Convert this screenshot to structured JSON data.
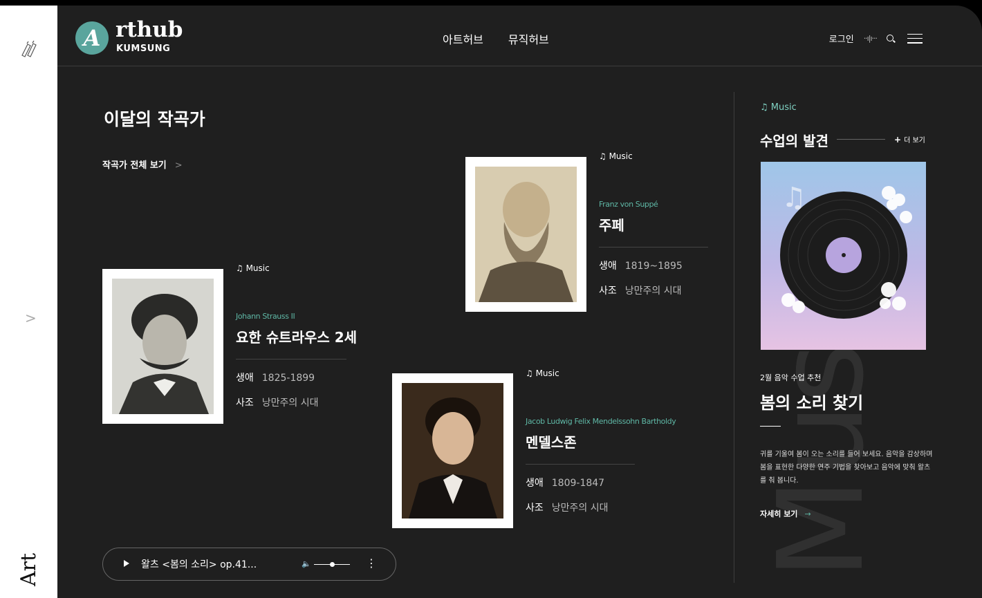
{
  "rail": {
    "art_label": "Art"
  },
  "brand": {
    "logo_letter": "A",
    "name": "rthub",
    "sub": "KUMSUNG"
  },
  "nav": {
    "items": [
      "아트허브",
      "뮤직허브"
    ]
  },
  "utils": {
    "login": "로그인",
    "wave": "··ı|ı···"
  },
  "section": {
    "title": "이달의 작곡가",
    "all_link": "작곡가 전체 보기",
    "all_link_chevron": ">"
  },
  "composers": [
    {
      "tag": "♫ Music",
      "eng": "Johann Strauss II",
      "kor": "요한 슈트라우스 2세",
      "life_label": "생애",
      "life": "1825-1899",
      "era_label": "사조",
      "era": "낭만주의 시대"
    },
    {
      "tag": "♫ Music",
      "eng": "Franz von Suppé",
      "kor": "주페",
      "life_label": "생애",
      "life": "1819~1895",
      "era_label": "사조",
      "era": "낭만주의 시대"
    },
    {
      "tag": "♫ Music",
      "eng": "Jacob Ludwig Felix Mendelssohn Bartholdy",
      "kor": "멘델스존",
      "life_label": "생애",
      "life": "1809-1847",
      "era_label": "사조",
      "era": "낭만주의 시대"
    }
  ],
  "player": {
    "track": "왈츠 <봄의 소리> op.41...",
    "volume": 0.5
  },
  "side": {
    "tag": "♫ Music",
    "title": "수업의 발견",
    "more": "더 보기",
    "rec_label": "2월 음악 수업 추천",
    "rec_title": "봄의 소리 찾기",
    "rec_desc": "귀를 기울여 봄이 오는 소리를 들어 보세요. 음악을 감상하며 봄을 표현한 다양한 연주 기법을 찾아보고 음악에 맞춰 왈츠를 춰 봅니다.",
    "detail": "자세히 보기",
    "big_word": "Music"
  },
  "colors": {
    "accent": "#5fb8a6",
    "background": "#1f1f1f",
    "logo": "#5aa59d"
  }
}
